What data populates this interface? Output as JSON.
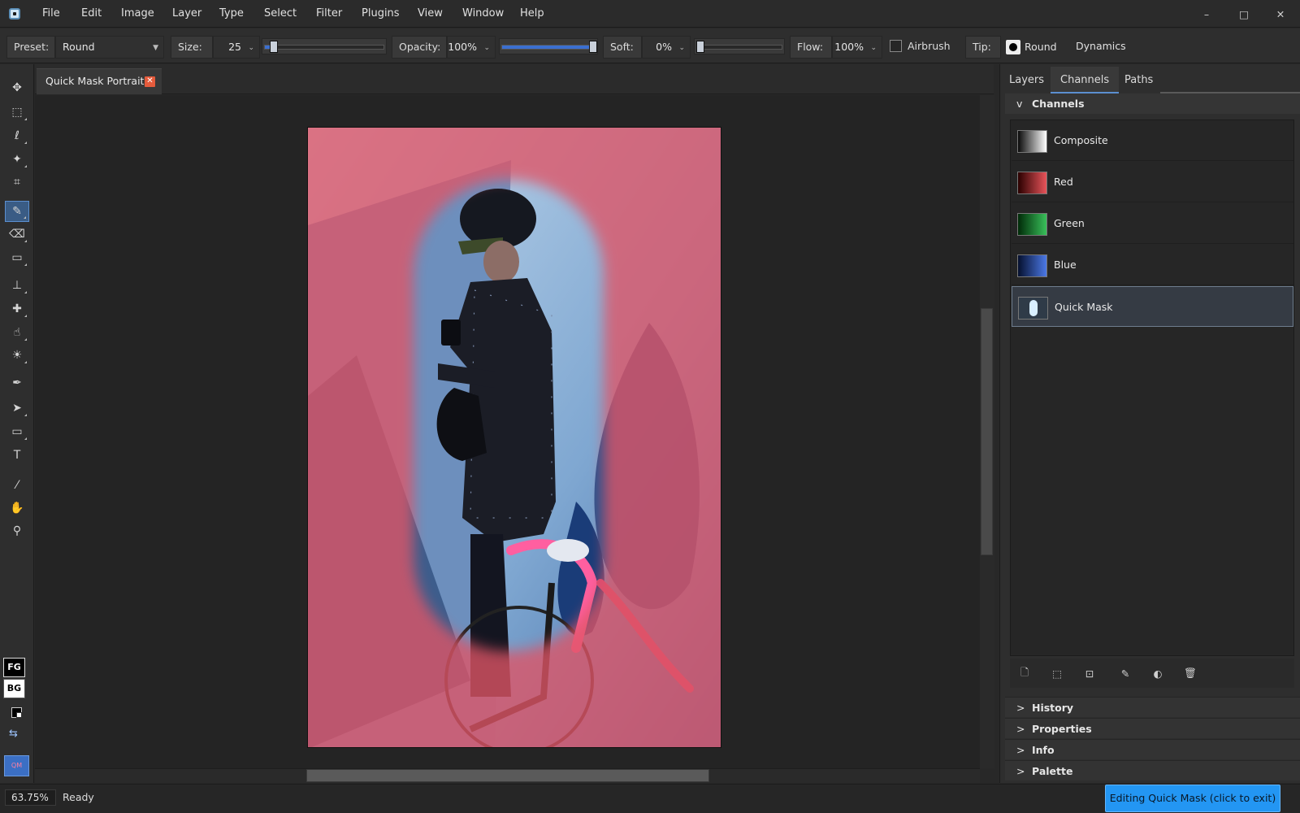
{
  "menubar": {
    "items": [
      "File",
      "Edit",
      "Image",
      "Layer",
      "Type",
      "Select",
      "Filter",
      "Plugins",
      "View",
      "Window",
      "Help"
    ]
  },
  "window_controls": {
    "minimize": "–",
    "maximize": "□",
    "close": "✕"
  },
  "options": {
    "preset_label": "Preset:",
    "preset_value": "Round",
    "size_label": "Size:",
    "size_value": "25",
    "size_level": 0.05,
    "opacity_label": "Opacity:",
    "opacity_value": "100%",
    "opacity_level": 1.0,
    "soft_label": "Soft:",
    "soft_value": "0%",
    "soft_level": 0.0,
    "flow_label": "Flow:",
    "flow_value": "100%",
    "airbrush_label": "Airbrush",
    "airbrush_checked": false,
    "tip_label": "Tip:",
    "tip_value": "Round",
    "dynamics_label": "Dynamics"
  },
  "toolbox": {
    "tools": [
      {
        "name": "move-tool",
        "icon": "✥"
      },
      {
        "name": "marquee-tool",
        "icon": "⬚"
      },
      {
        "name": "lasso-tool",
        "icon": "ℓ"
      },
      {
        "name": "magic-wand-tool",
        "icon": "✦"
      },
      {
        "name": "crop-tool",
        "icon": "⌗"
      },
      {
        "name": "brush-tool",
        "icon": "✎",
        "active": true
      },
      {
        "name": "eraser-tool",
        "icon": "⌫"
      },
      {
        "name": "gradient-tool",
        "icon": "▭"
      },
      {
        "name": "stamp-tool",
        "icon": "⊥"
      },
      {
        "name": "healing-tool",
        "icon": "✚"
      },
      {
        "name": "smudge-tool",
        "icon": "☝"
      },
      {
        "name": "dodge-tool",
        "icon": "☀"
      },
      {
        "name": "pen-tool",
        "icon": "✒"
      },
      {
        "name": "path-select-tool",
        "icon": "➤"
      },
      {
        "name": "shape-tool",
        "icon": "▭"
      },
      {
        "name": "type-tool",
        "icon": "T"
      },
      {
        "name": "eyedropper-tool",
        "icon": "⁄"
      },
      {
        "name": "hand-tool",
        "icon": "✋"
      },
      {
        "name": "zoom-tool",
        "icon": "⚲"
      }
    ],
    "fg_label": "FG",
    "bg_label": "BG",
    "swap_icon": "⇆",
    "quickmask_label": "QM"
  },
  "document": {
    "tab_title": "Quick Mask Portrait",
    "close_icon": "✕"
  },
  "panel_tabs": [
    "Layers",
    "Channels",
    "Paths"
  ],
  "active_panel_tab": "Channels",
  "channels_panel": {
    "title": "Channels",
    "collapse_glyph": "v",
    "channels": [
      {
        "name": "Composite",
        "swatch": "composite"
      },
      {
        "name": "Red",
        "swatch": "red"
      },
      {
        "name": "Green",
        "swatch": "green"
      },
      {
        "name": "Blue",
        "swatch": "blue"
      },
      {
        "name": "Quick Mask",
        "swatch": "mask",
        "selected": true
      }
    ],
    "actions": [
      "new-channel-icon",
      "load-selection-icon",
      "save-selection-icon",
      "edit-channel-icon",
      "invert-icon",
      "trash-icon"
    ]
  },
  "collapsed_panels": [
    "History",
    "Properties",
    "Info",
    "Palette"
  ],
  "statusbar": {
    "zoom": "63.75%",
    "status": "Ready",
    "quickmask_exit": "Editing Quick Mask (click to exit)"
  },
  "colors": {
    "accent": "#3b6fd1",
    "quickmask_button": "#2396f3",
    "mask_overlay": "#e05566",
    "tab_close": "#e55b3c"
  }
}
